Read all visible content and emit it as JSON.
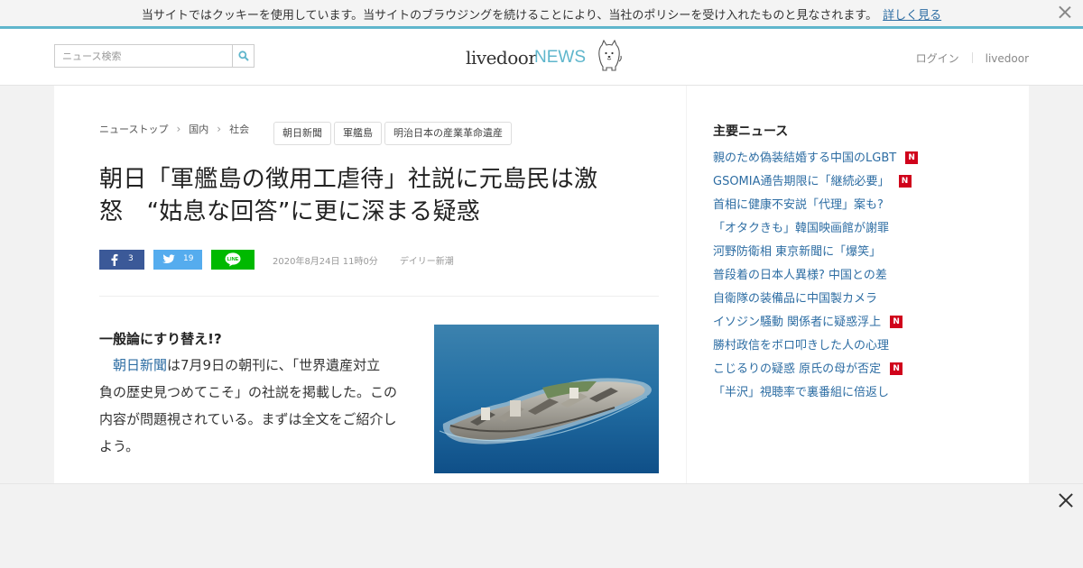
{
  "cookie_bar": {
    "message": "当サイトではクッキーを使用しています。当サイトのブラウジングを続けることにより、当社のポリシーを受け入れたものと見なされます。",
    "link": "詳しく見る",
    "close_icon": "close-icon"
  },
  "header": {
    "search_placeholder": "ニュース検索",
    "search_icon": "search-icon",
    "logo_livedoor": "livedoor",
    "logo_news": "NEWS",
    "login": "ログイン",
    "livedoor": "livedoor"
  },
  "breadcrumb": [
    "ニューストップ",
    "国内",
    "社会"
  ],
  "tags": [
    "朝日新聞",
    "軍艦島",
    "明治日本の産業革命遺産"
  ],
  "article": {
    "title": "朝日「軍艦島の徴用工虐待」社説に元島民は激怒　“姑息な回答”に更に深まる疑惑",
    "share": {
      "facebook_count": "3",
      "twitter_count": "19",
      "line_label": "LINE"
    },
    "date": "2020年8月24日 11時0分",
    "source": "デイリー新潮",
    "subheading": "一般論にすり替え!?",
    "body_link": "朝日新聞",
    "body_text": "は7月9日の朝刊に、「世界遺産対立　負の歴史見つめてこそ」の社説を掲載した。この内容が問題視されている。まずは全文をご紹介しよう。"
  },
  "sidebar": {
    "heading": "主要ニュース",
    "items": [
      {
        "text": "親のため偽装結婚する中国のLGBT",
        "badge": "N"
      },
      {
        "text": "GSOMIA通告期限に「継続必要」",
        "badge": "N"
      },
      {
        "text": "首相に健康不安説「代理」案も?",
        "badge": ""
      },
      {
        "text": "「オタクきも」韓国映画館が謝罪",
        "badge": ""
      },
      {
        "text": "河野防衛相 東京新聞に「爆笑」",
        "badge": ""
      },
      {
        "text": "普段着の日本人異様? 中国との差",
        "badge": ""
      },
      {
        "text": "自衛隊の装備品に中国製カメラ",
        "badge": ""
      },
      {
        "text": "イソジン騒動 関係者に疑惑浮上",
        "badge": "N"
      },
      {
        "text": "勝村政信をボロ叩きした人の心理",
        "badge": ""
      },
      {
        "text": "こじるりの疑惑 原氏の母が否定",
        "badge": "N"
      },
      {
        "text": "「半沢」視聴率で裏番組に倍返し",
        "badge": ""
      }
    ]
  },
  "colors": {
    "accent": "#5fb6cc",
    "link": "#2d6da3",
    "facebook": "#3b5998",
    "twitter": "#55acee",
    "line": "#00b900",
    "badge": "#d0021b"
  }
}
